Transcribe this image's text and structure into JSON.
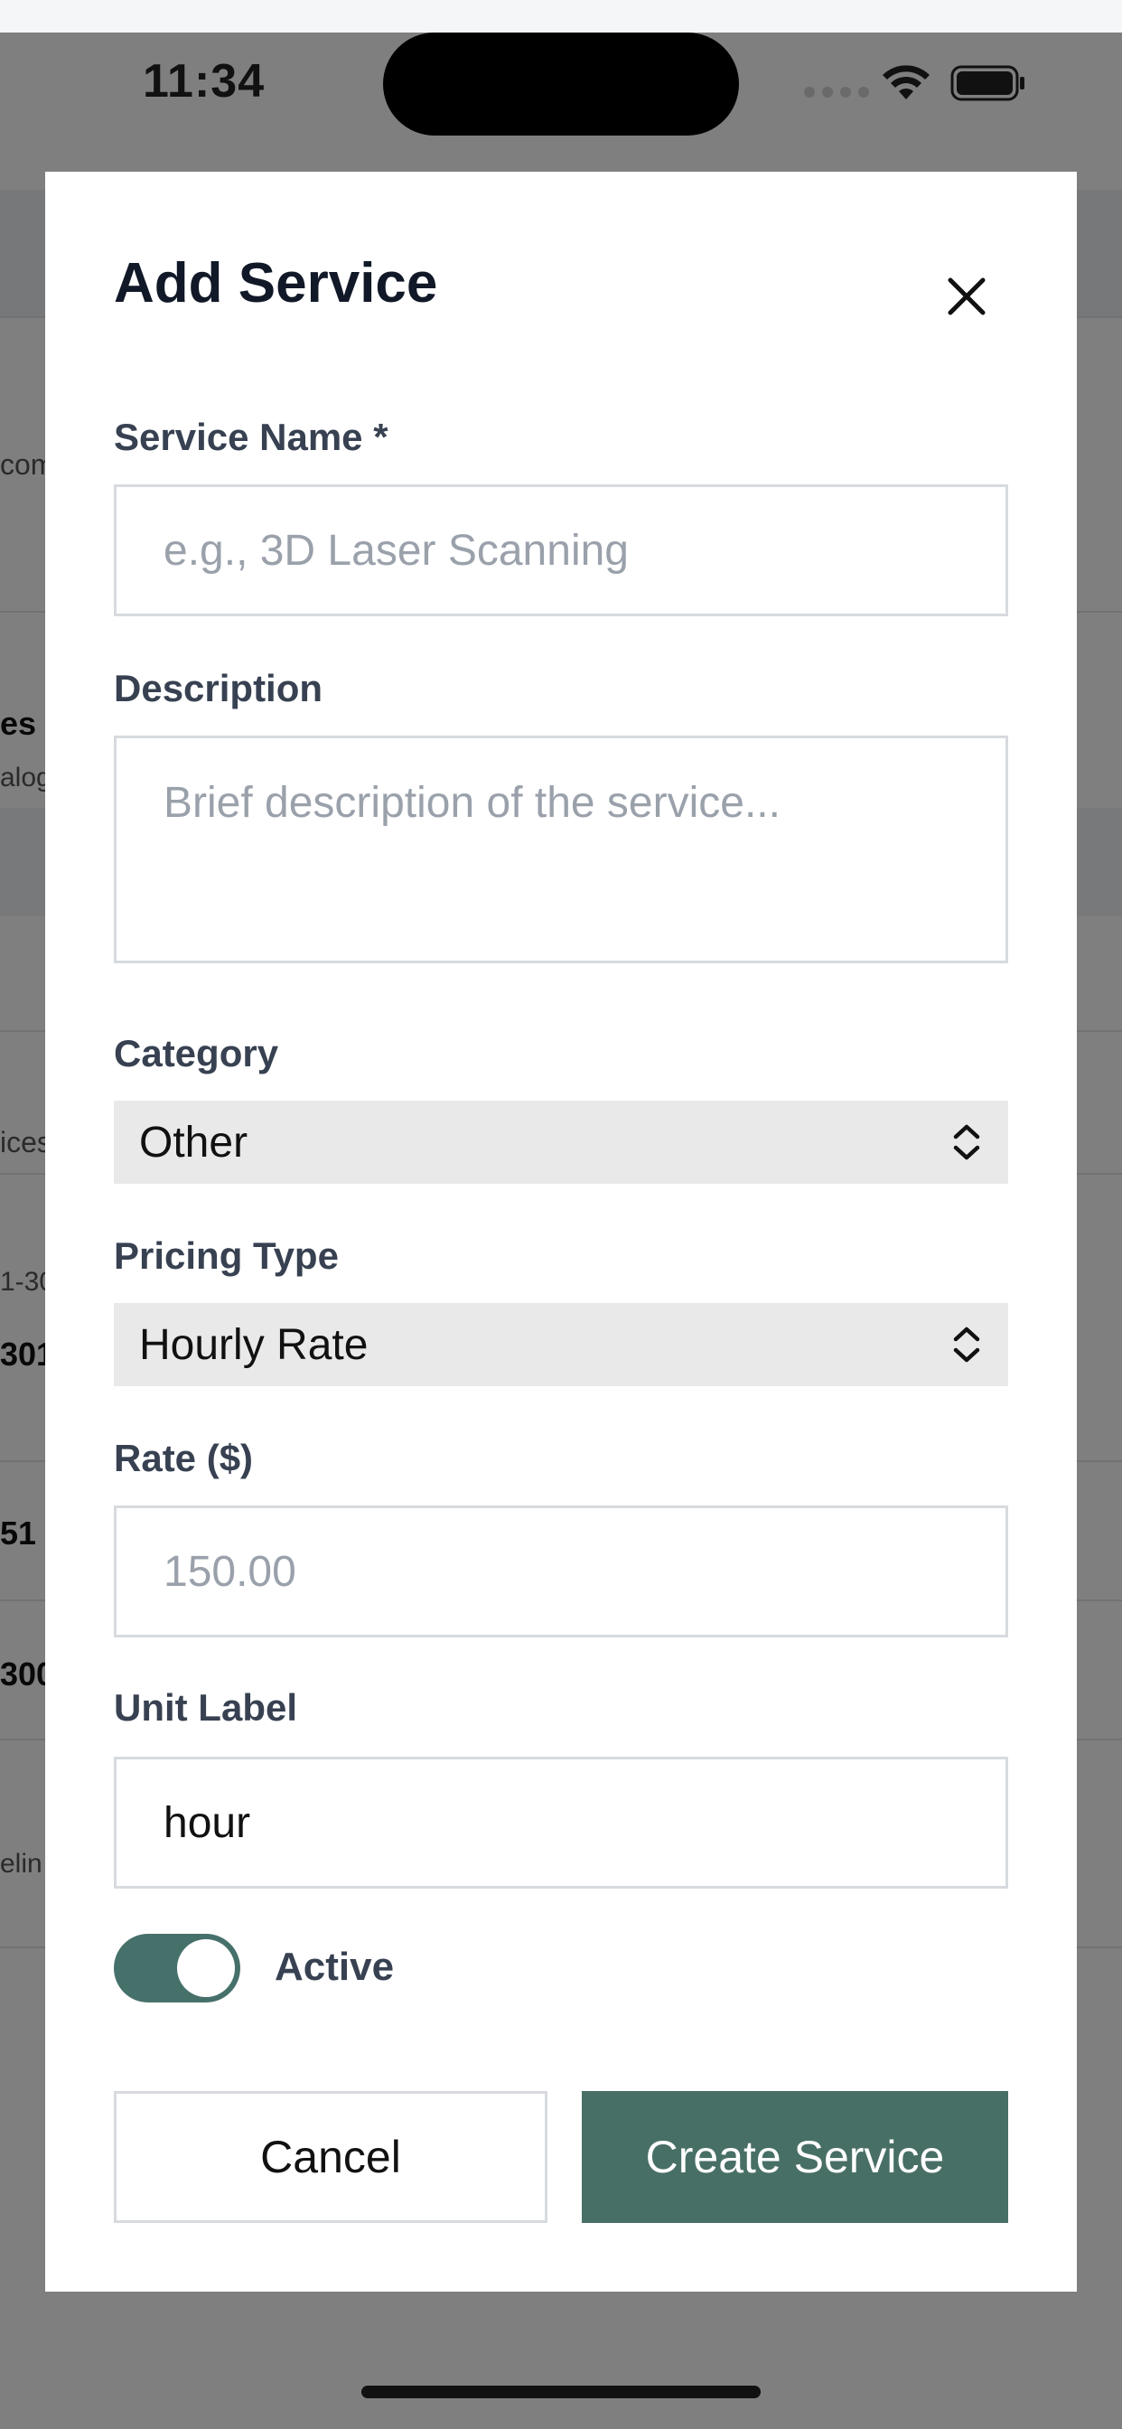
{
  "status_bar": {
    "time": "11:34"
  },
  "background": {
    "fragments": [
      "com",
      "es",
      "alog",
      "ices",
      "1-30",
      "301",
      "51",
      "300",
      "elin"
    ]
  },
  "modal": {
    "title": "Add Service",
    "fields": {
      "service_name": {
        "label": "Service Name *",
        "placeholder": "e.g., 3D Laser Scanning",
        "value": ""
      },
      "description": {
        "label": "Description",
        "placeholder": "Brief description of the service...",
        "value": ""
      },
      "category": {
        "label": "Category",
        "selected": "Other"
      },
      "pricing_type": {
        "label": "Pricing Type",
        "selected": "Hourly Rate"
      },
      "rate": {
        "label": "Rate ($)",
        "placeholder": "150.00",
        "value": ""
      },
      "unit_label": {
        "label": "Unit Label",
        "value": "hour"
      }
    },
    "active_toggle": {
      "label": "Active",
      "on": true
    },
    "buttons": {
      "cancel": "Cancel",
      "create": "Create Service"
    }
  },
  "colors": {
    "accent": "#486f66",
    "toggle_on": "#46706a",
    "border": "#d7dade",
    "select_bg": "#e9e9ea"
  }
}
